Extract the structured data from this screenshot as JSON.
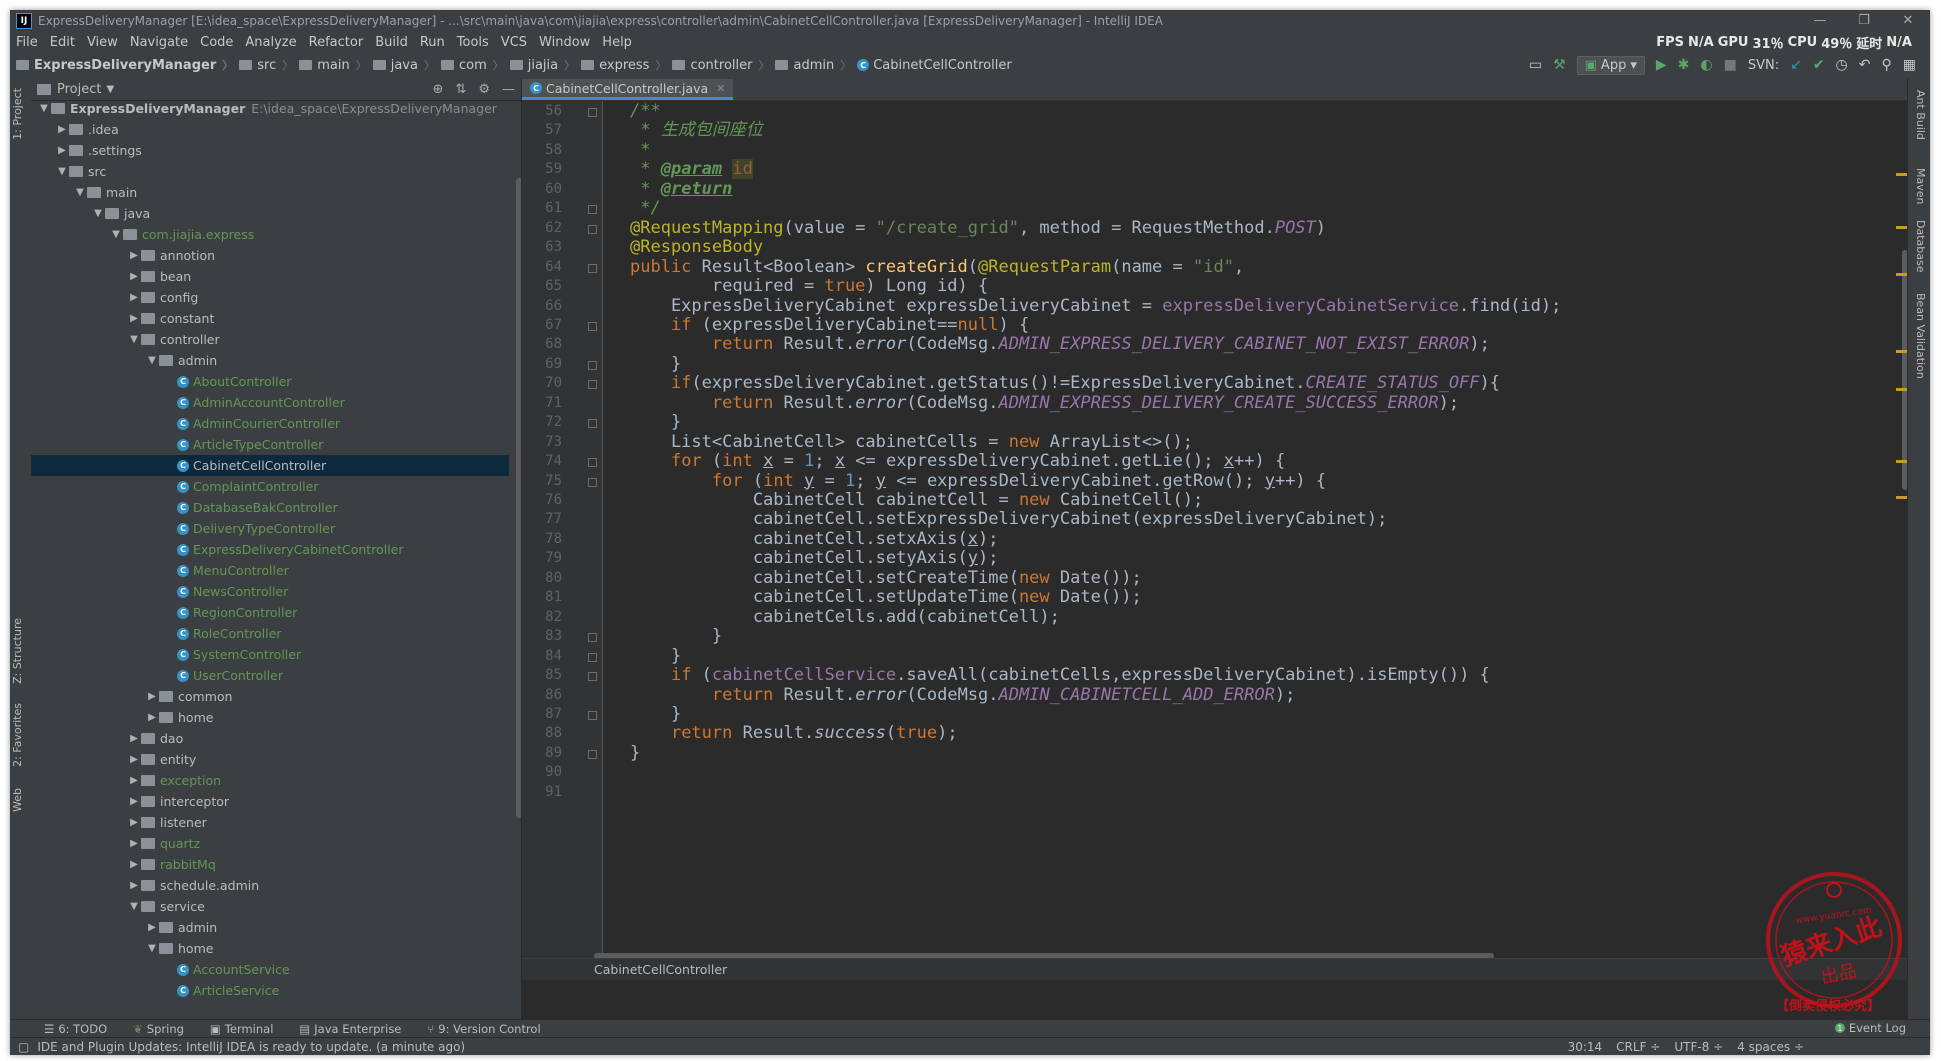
{
  "window": {
    "title": "ExpressDeliveryManager [E:\\idea_space\\ExpressDeliveryManager] - ...\\src\\main\\java\\com\\jiajia\\express\\controller\\admin\\CabinetCellController.java [ExpressDeliveryManager] - IntelliJ IDEA",
    "minimize": "—",
    "restore": "❐",
    "close": "✕"
  },
  "menu": [
    "File",
    "Edit",
    "View",
    "Navigate",
    "Code",
    "Analyze",
    "Refactor",
    "Build",
    "Run",
    "Tools",
    "VCS",
    "Window",
    "Help"
  ],
  "perf": {
    "fps_label": "FPS",
    "fps": "N/A",
    "gpu_label": "GPU",
    "gpu": "31％",
    "cpu_label": "CPU",
    "cpu": "49％",
    "lag_label": "延时",
    "lag": "N/A"
  },
  "breadcrumbs": [
    "ExpressDeliveryManager",
    "src",
    "main",
    "java",
    "com",
    "jiajia",
    "express",
    "controller",
    "admin",
    "CabinetCellController"
  ],
  "toolbar": {
    "run_config": "App",
    "svn_label": "SVN:"
  },
  "project_panel": {
    "title": "Project",
    "root_path": "E:\\idea_space\\ExpressDeliveryManager",
    "tree": [
      {
        "label": "ExpressDeliveryManager",
        "depth": 0,
        "arrow": "▼",
        "icon": "module",
        "bold": true
      },
      {
        "label": ".idea",
        "depth": 1,
        "arrow": "▶",
        "icon": "folder"
      },
      {
        "label": ".settings",
        "depth": 1,
        "arrow": "▶",
        "icon": "folder"
      },
      {
        "label": "src",
        "depth": 1,
        "arrow": "▼",
        "icon": "folder"
      },
      {
        "label": "main",
        "depth": 2,
        "arrow": "▼",
        "icon": "folder"
      },
      {
        "label": "java",
        "depth": 3,
        "arrow": "▼",
        "icon": "folder"
      },
      {
        "label": "com.jiajia.express",
        "depth": 4,
        "arrow": "▼",
        "icon": "pkg",
        "green": true
      },
      {
        "label": "annotion",
        "depth": 5,
        "arrow": "▶",
        "icon": "pkg"
      },
      {
        "label": "bean",
        "depth": 5,
        "arrow": "▶",
        "icon": "pkg"
      },
      {
        "label": "config",
        "depth": 5,
        "arrow": "▶",
        "icon": "pkg"
      },
      {
        "label": "constant",
        "depth": 5,
        "arrow": "▶",
        "icon": "pkg"
      },
      {
        "label": "controller",
        "depth": 5,
        "arrow": "▼",
        "icon": "pkg"
      },
      {
        "label": "admin",
        "depth": 6,
        "arrow": "▼",
        "icon": "pkg"
      },
      {
        "label": "AboutController",
        "depth": 7,
        "icon": "class",
        "green": true
      },
      {
        "label": "AdminAccountController",
        "depth": 7,
        "icon": "class",
        "green": true
      },
      {
        "label": "AdminCourierController",
        "depth": 7,
        "icon": "class",
        "green": true
      },
      {
        "label": "ArticleTypeController",
        "depth": 7,
        "icon": "class",
        "green": true
      },
      {
        "label": "CabinetCellController",
        "depth": 7,
        "icon": "class",
        "selected": true
      },
      {
        "label": "ComplaintController",
        "depth": 7,
        "icon": "class",
        "green": true
      },
      {
        "label": "DatabaseBakController",
        "depth": 7,
        "icon": "class",
        "green": true
      },
      {
        "label": "DeliveryTypeController",
        "depth": 7,
        "icon": "class",
        "green": true
      },
      {
        "label": "ExpressDeliveryCabinetController",
        "depth": 7,
        "icon": "class",
        "green": true
      },
      {
        "label": "MenuController",
        "depth": 7,
        "icon": "class",
        "green": true
      },
      {
        "label": "NewsController",
        "depth": 7,
        "icon": "class",
        "green": true
      },
      {
        "label": "RegionController",
        "depth": 7,
        "icon": "class",
        "green": true
      },
      {
        "label": "RoleController",
        "depth": 7,
        "icon": "class",
        "green": true
      },
      {
        "label": "SystemController",
        "depth": 7,
        "icon": "class",
        "green": true
      },
      {
        "label": "UserController",
        "depth": 7,
        "icon": "class",
        "green": true
      },
      {
        "label": "common",
        "depth": 6,
        "arrow": "▶",
        "icon": "pkg"
      },
      {
        "label": "home",
        "depth": 6,
        "arrow": "▶",
        "icon": "pkg"
      },
      {
        "label": "dao",
        "depth": 5,
        "arrow": "▶",
        "icon": "pkg"
      },
      {
        "label": "entity",
        "depth": 5,
        "arrow": "▶",
        "icon": "pkg"
      },
      {
        "label": "exception",
        "depth": 5,
        "arrow": "▶",
        "icon": "pkg",
        "green": true
      },
      {
        "label": "interceptor",
        "depth": 5,
        "arrow": "▶",
        "icon": "pkg"
      },
      {
        "label": "listener",
        "depth": 5,
        "arrow": "▶",
        "icon": "pkg"
      },
      {
        "label": "quartz",
        "depth": 5,
        "arrow": "▶",
        "icon": "pkg",
        "green": true
      },
      {
        "label": "rabbitMq",
        "depth": 5,
        "arrow": "▶",
        "icon": "pkg",
        "green": true
      },
      {
        "label": "schedule.admin",
        "depth": 5,
        "arrow": "▶",
        "icon": "pkg"
      },
      {
        "label": "service",
        "depth": 5,
        "arrow": "▼",
        "icon": "pkg"
      },
      {
        "label": "admin",
        "depth": 6,
        "arrow": "▶",
        "icon": "pkg"
      },
      {
        "label": "home",
        "depth": 6,
        "arrow": "▼",
        "icon": "pkg"
      },
      {
        "label": "AccountService",
        "depth": 7,
        "icon": "class",
        "green": true
      },
      {
        "label": "ArticleService",
        "depth": 7,
        "icon": "class",
        "green": true
      }
    ]
  },
  "left_tool_tabs": [
    "1: Project",
    "Z: Structure",
    "2: Favorites",
    "Web"
  ],
  "right_tool_tabs": [
    "Ant Build",
    "Maven",
    "Database",
    "Bean Validation"
  ],
  "editor": {
    "tab": "CabinetCellController.java",
    "breadcrumb": "CabinetCellController",
    "first_line": 56,
    "lines": [
      [
        [
          "doc",
          "/**"
        ]
      ],
      [
        [
          "doc",
          " * 生成包间座位"
        ]
      ],
      [
        [
          "doc",
          " *"
        ]
      ],
      [
        [
          "doc",
          " * "
        ],
        [
          "doctag",
          "@param"
        ],
        [
          "doc",
          " "
        ],
        [
          "docval",
          "id"
        ]
      ],
      [
        [
          "doc",
          " * "
        ],
        [
          "doctag",
          "@return"
        ]
      ],
      [
        [
          "doc",
          " */"
        ]
      ],
      [
        [
          "ann",
          "@RequestMapping"
        ],
        [
          "",
          "(value = "
        ],
        [
          "str",
          "\"/create_grid\""
        ],
        [
          "",
          ", method = RequestMethod."
        ],
        [
          "stat",
          "POST"
        ],
        [
          "",
          ")"
        ]
      ],
      [
        [
          "ann",
          "@ResponseBody"
        ]
      ],
      [
        [
          "kw",
          "public "
        ],
        [
          "",
          "Result<Boolean> "
        ],
        [
          "meth",
          "createGrid"
        ],
        [
          "",
          "("
        ],
        [
          "ann",
          "@RequestParam"
        ],
        [
          "",
          "(name = "
        ],
        [
          "str",
          "\"id\""
        ],
        [
          "",
          ","
        ]
      ],
      [
        [
          "",
          "        required = "
        ],
        [
          "kw",
          "true"
        ],
        [
          "",
          ") Long id) {"
        ]
      ],
      [
        [
          "",
          "    ExpressDeliveryCabinet expressDeliveryCabinet = "
        ],
        [
          "fld",
          "expressDeliveryCabinetService"
        ],
        [
          "",
          ".find(id);"
        ]
      ],
      [
        [
          "",
          "    "
        ],
        [
          "kw",
          "if "
        ],
        [
          "",
          "(expressDeliveryCabinet=="
        ],
        [
          "kw",
          "null"
        ],
        [
          "",
          ") {"
        ]
      ],
      [
        [
          "",
          "        "
        ],
        [
          "kw",
          "return "
        ],
        [
          "",
          "Result."
        ],
        [
          "ital",
          "error"
        ],
        [
          "",
          "(CodeMsg."
        ],
        [
          "stat",
          "ADMIN_EXPRESS_DELIVERY_CABINET_NOT_EXIST_ERROR"
        ],
        [
          "",
          ");"
        ]
      ],
      [
        [
          "",
          "    }"
        ]
      ],
      [
        [
          "",
          "    "
        ],
        [
          "kw",
          "if"
        ],
        [
          "",
          "(expressDeliveryCabinet.getStatus()!=ExpressDeliveryCabinet."
        ],
        [
          "stat",
          "CREATE_STATUS_OFF"
        ],
        [
          "",
          "){"
        ]
      ],
      [
        [
          "",
          "        "
        ],
        [
          "kw",
          "return "
        ],
        [
          "",
          "Result."
        ],
        [
          "ital",
          "error"
        ],
        [
          "",
          "(CodeMsg."
        ],
        [
          "stat",
          "ADMIN_EXPRESS_DELIVERY_CREATE_SUCCESS_ERROR"
        ],
        [
          "",
          ");"
        ]
      ],
      [
        [
          "",
          "    }"
        ]
      ],
      [
        [
          "",
          "    List<CabinetCell> cabinetCells = "
        ],
        [
          "kw",
          "new "
        ],
        [
          "",
          "ArrayList<>();"
        ]
      ],
      [
        [
          "",
          "    "
        ],
        [
          "kw",
          "for "
        ],
        [
          "",
          "("
        ],
        [
          "kw",
          "int "
        ],
        [
          "param",
          "x"
        ],
        [
          "",
          " = "
        ],
        [
          "num",
          "1"
        ],
        [
          "",
          "; "
        ],
        [
          "param",
          "x"
        ],
        [
          "",
          " <= expressDeliveryCabinet.getLie(); "
        ],
        [
          "param",
          "x"
        ],
        [
          "",
          "++) {"
        ]
      ],
      [
        [
          "",
          "        "
        ],
        [
          "kw",
          "for "
        ],
        [
          "",
          "("
        ],
        [
          "kw",
          "int "
        ],
        [
          "param",
          "y"
        ],
        [
          "",
          " = "
        ],
        [
          "num",
          "1"
        ],
        [
          "",
          "; "
        ],
        [
          "param",
          "y"
        ],
        [
          "",
          " <= expressDeliveryCabinet.getRow(); "
        ],
        [
          "param",
          "y"
        ],
        [
          "",
          "++) {"
        ]
      ],
      [
        [
          "",
          "            CabinetCell cabinetCell = "
        ],
        [
          "kw",
          "new "
        ],
        [
          "",
          "CabinetCell();"
        ]
      ],
      [
        [
          "",
          "            cabinetCell.setExpressDeliveryCabinet(expressDeliveryCabinet);"
        ]
      ],
      [
        [
          "",
          "            cabinetCell.setxAxis("
        ],
        [
          "param",
          "x"
        ],
        [
          "",
          ");"
        ]
      ],
      [
        [
          "",
          "            cabinetCell.setyAxis("
        ],
        [
          "param",
          "y"
        ],
        [
          "",
          ");"
        ]
      ],
      [
        [
          "",
          "            cabinetCell.setCreateTime("
        ],
        [
          "kw",
          "new "
        ],
        [
          "",
          "Date());"
        ]
      ],
      [
        [
          "",
          "            cabinetCell.setUpdateTime("
        ],
        [
          "kw",
          "new "
        ],
        [
          "",
          "Date());"
        ]
      ],
      [
        [
          "",
          "            cabinetCells.add(cabinetCell);"
        ]
      ],
      [
        [
          "",
          "        }"
        ]
      ],
      [
        [
          "",
          "    }"
        ]
      ],
      [
        [
          "",
          "    "
        ],
        [
          "kw",
          "if "
        ],
        [
          "",
          "("
        ],
        [
          "fld",
          "cabinetCellService"
        ],
        [
          "",
          ".saveAll(cabinetCells,expressDeliveryCabinet).isEmpty()) {"
        ]
      ],
      [
        [
          "",
          "        "
        ],
        [
          "kw",
          "return "
        ],
        [
          "",
          "Result."
        ],
        [
          "ital",
          "error"
        ],
        [
          "",
          "(CodeMsg."
        ],
        [
          "stat",
          "ADMIN_CABINETCELL_ADD_ERROR"
        ],
        [
          "",
          ");"
        ]
      ],
      [
        [
          "",
          "    }"
        ]
      ],
      [
        [
          "",
          "    "
        ],
        [
          "kw",
          "return "
        ],
        [
          "",
          "Result."
        ],
        [
          "ital",
          "success"
        ],
        [
          "",
          "("
        ],
        [
          "kw",
          "true"
        ],
        [
          "",
          ");"
        ]
      ],
      [
        [
          "",
          "}"
        ]
      ],
      [
        [
          "",
          " "
        ]
      ],
      [
        [
          "",
          " "
        ]
      ]
    ]
  },
  "bottom_tabs": [
    "6: TODO",
    "Spring",
    "Terminal",
    "Java Enterprise",
    "9: Version Control"
  ],
  "status": {
    "message": "IDE and Plugin Updates: IntelliJ IDEA is ready to update. (a minute ago)",
    "position": "30:14",
    "line_sep": "CRLF ÷",
    "encoding": "UTF-8 ÷",
    "indent": "4 spaces ÷",
    "event_log": "Event Log"
  },
  "watermark": {
    "top": "www.yuanrc.com",
    "main": "猿来入此",
    "sub": "出品",
    "ribbon": "【倒卖侵权必究】"
  },
  "colors": {
    "bg": "#2b2b2b",
    "panel": "#3c3f41",
    "selection": "#0d293e",
    "keyword": "#cc7832",
    "string": "#6a8759",
    "annotation": "#bbb529",
    "constant": "#9876aa",
    "method": "#ffc66d",
    "seal": "#c0121b"
  }
}
